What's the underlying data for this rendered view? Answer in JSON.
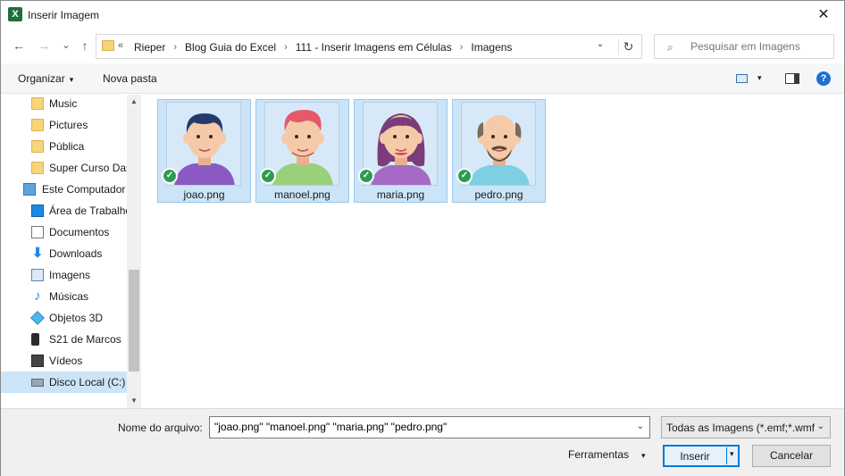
{
  "window": {
    "title": "Inserir Imagem",
    "close_glyph": "✕"
  },
  "nav_buttons": {
    "back": "←",
    "forward": "→",
    "recent": "⌄",
    "up": "↑"
  },
  "address": {
    "more": "«",
    "crumbs": [
      "Rieper",
      "Blog Guia do Excel",
      "111 - Inserir Imagens em Células",
      "Imagens"
    ],
    "separator": "›",
    "dropdown": "⌄",
    "refresh": "↻"
  },
  "search": {
    "placeholder": "Pesquisar em Imagens",
    "icon": "⌕"
  },
  "toolbar": {
    "organize": "Organizar",
    "organize_arrow": "▾",
    "new_folder": "Nova pasta",
    "view_arrow": "▾",
    "help": "?"
  },
  "nav_pane": {
    "items": [
      {
        "label": "Music",
        "icon": "folder-icon"
      },
      {
        "label": "Pictures",
        "icon": "folder-icon"
      },
      {
        "label": "Pública",
        "icon": "folder-icon"
      },
      {
        "label": "Super Curso Das",
        "icon": "folder-icon"
      },
      {
        "label": "Este Computador",
        "icon": "computer-icon"
      },
      {
        "label": "Área de Trabalho",
        "icon": "desktop-icon"
      },
      {
        "label": "Documentos",
        "icon": "documents-icon"
      },
      {
        "label": "Downloads",
        "icon": "downloads-icon"
      },
      {
        "label": "Imagens",
        "icon": "pictures-icon"
      },
      {
        "label": "Músicas",
        "icon": "music-icon"
      },
      {
        "label": "Objetos 3D",
        "icon": "3d-objects-icon"
      },
      {
        "label": "S21 de Marcos",
        "icon": "phone-icon"
      },
      {
        "label": "Vídeos",
        "icon": "videos-icon"
      },
      {
        "label": "Disco Local (C:)",
        "icon": "drive-icon",
        "selected": true
      }
    ],
    "scroll_up": "▲",
    "scroll_down": "▼"
  },
  "files": [
    {
      "name": "joao.png",
      "avatar": "joao",
      "selected": true
    },
    {
      "name": "manoel.png",
      "avatar": "manoel",
      "selected": true
    },
    {
      "name": "maria.png",
      "avatar": "maria",
      "selected": true
    },
    {
      "name": "pedro.png",
      "avatar": "pedro",
      "selected": true
    }
  ],
  "sync_glyph": "✓",
  "bottom": {
    "filename_label": "Nome do arquivo:",
    "filename_value": "\"joao.png\" \"manoel.png\" \"maria.png\" \"pedro.png\"",
    "filename_dd": "⌄",
    "filter": "Todas as Imagens (*.emf;*.wmf;",
    "filter_dd": "⌄",
    "tools": "Ferramentas",
    "tools_arrow": "▾",
    "insert": "Inserir",
    "insert_arrow": "▾",
    "cancel": "Cancelar"
  },
  "colors": {
    "selection": "#cce4f7",
    "accent": "#0078d7",
    "excel_green": "#1d6f42",
    "sync_green": "#2e9b55"
  }
}
